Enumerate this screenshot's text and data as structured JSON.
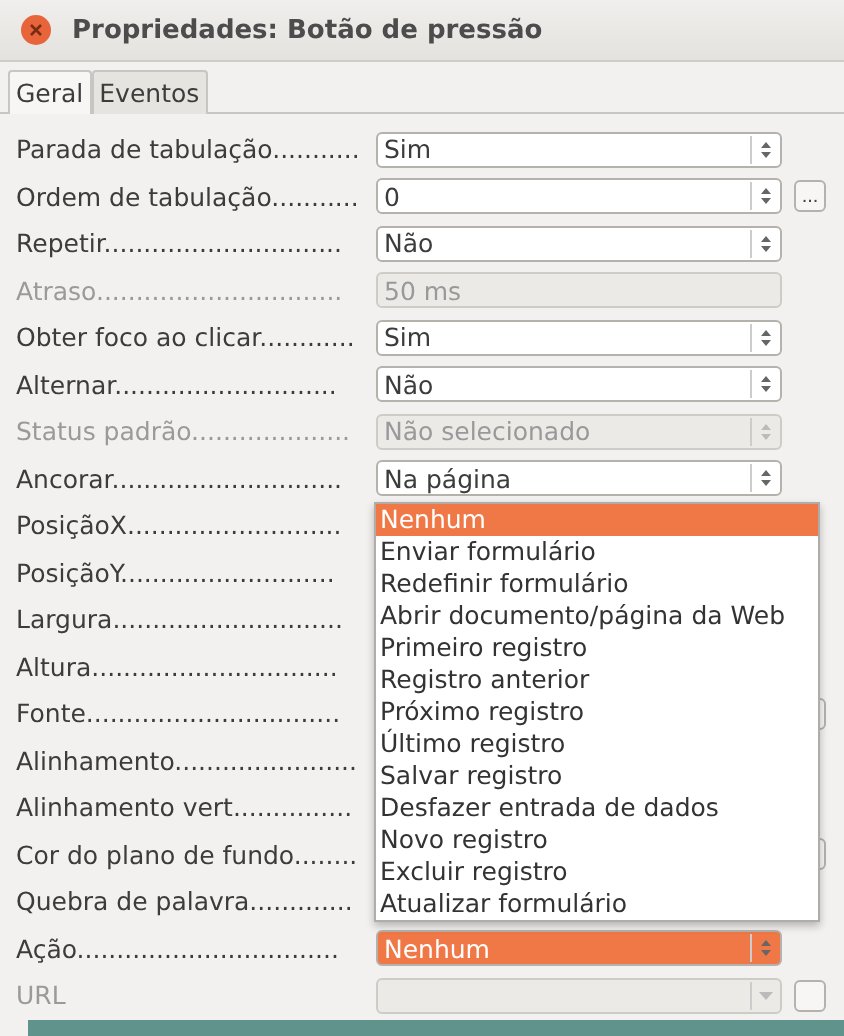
{
  "window": {
    "title": "Propriedades: Botão de pressão"
  },
  "tabs": [
    {
      "label": "Geral",
      "selected": true
    },
    {
      "label": "Eventos",
      "selected": false
    }
  ],
  "rows": [
    {
      "label": "Parada de tabulação...........",
      "disabled": false,
      "control": {
        "kind": "combo",
        "value": "Sim",
        "disabled": false,
        "highlighted": false
      },
      "more_button": false
    },
    {
      "label": "Ordem de tabulação...........",
      "disabled": false,
      "control": {
        "kind": "spin",
        "value": "0",
        "disabled": false,
        "highlighted": false
      },
      "more_button": true,
      "more_label": "..."
    },
    {
      "label": "Repetir..............................",
      "disabled": false,
      "control": {
        "kind": "combo",
        "value": "Não",
        "disabled": false,
        "highlighted": false
      },
      "more_button": false
    },
    {
      "label": "Atraso...............................",
      "disabled": true,
      "control": {
        "kind": "text",
        "value": "50 ms",
        "disabled": true,
        "highlighted": false
      },
      "more_button": false
    },
    {
      "label": "Obter foco ao clicar............",
      "disabled": false,
      "control": {
        "kind": "combo",
        "value": "Sim",
        "disabled": false,
        "highlighted": false
      },
      "more_button": false
    },
    {
      "label": "Alternar............................",
      "disabled": false,
      "control": {
        "kind": "combo",
        "value": "Não",
        "disabled": false,
        "highlighted": false
      },
      "more_button": false
    },
    {
      "label": "Status padrão....................",
      "disabled": true,
      "control": {
        "kind": "combo",
        "value": "Não selecionado",
        "disabled": true,
        "highlighted": false
      },
      "more_button": false
    },
    {
      "label": "Ancorar.............................",
      "disabled": false,
      "control": {
        "kind": "combo",
        "value": "Na página",
        "disabled": false,
        "highlighted": false
      },
      "more_button": false
    },
    {
      "label": "PosiçãoX...........................",
      "disabled": false,
      "more_button": false
    },
    {
      "label": "PosiçãoY...........................",
      "disabled": false,
      "more_button": false
    },
    {
      "label": "Largura.............................",
      "disabled": false,
      "more_button": false
    },
    {
      "label": "Altura...............................",
      "disabled": false,
      "more_button": false
    },
    {
      "label": "Fonte................................",
      "disabled": false,
      "more_button": true
    },
    {
      "label": "Alinhamento.......................",
      "disabled": false,
      "more_button": false
    },
    {
      "label": "Alinhamento vert...............",
      "disabled": false,
      "more_button": false
    },
    {
      "label": "Cor do plano de fundo........",
      "disabled": false,
      "more_button": true
    },
    {
      "label": "Quebra de palavra.............",
      "disabled": false,
      "more_button": false
    },
    {
      "label": "Ação.................................",
      "disabled": false,
      "control": {
        "kind": "combo",
        "value": "Nenhum",
        "disabled": false,
        "highlighted": true
      },
      "more_button": false
    },
    {
      "label": "URL",
      "disabled": true,
      "control": {
        "kind": "dropdown",
        "disabled": true,
        "highlighted": false
      },
      "more_button": true
    }
  ],
  "dropdown": {
    "items": [
      {
        "label": "Nenhum",
        "selected": true
      },
      {
        "label": "Enviar formulário",
        "selected": false
      },
      {
        "label": "Redefinir formulário",
        "selected": false
      },
      {
        "label": "Abrir documento/página da Web",
        "selected": false
      },
      {
        "label": "Primeiro registro",
        "selected": false
      },
      {
        "label": "Registro anterior",
        "selected": false
      },
      {
        "label": "Próximo registro",
        "selected": false
      },
      {
        "label": "Último registro",
        "selected": false
      },
      {
        "label": "Salvar registro",
        "selected": false
      },
      {
        "label": "Desfazer entrada de dados",
        "selected": false
      },
      {
        "label": "Novo registro",
        "selected": false
      },
      {
        "label": "Excluir registro",
        "selected": false
      },
      {
        "label": "Atualizar formulário",
        "selected": false
      }
    ]
  }
}
